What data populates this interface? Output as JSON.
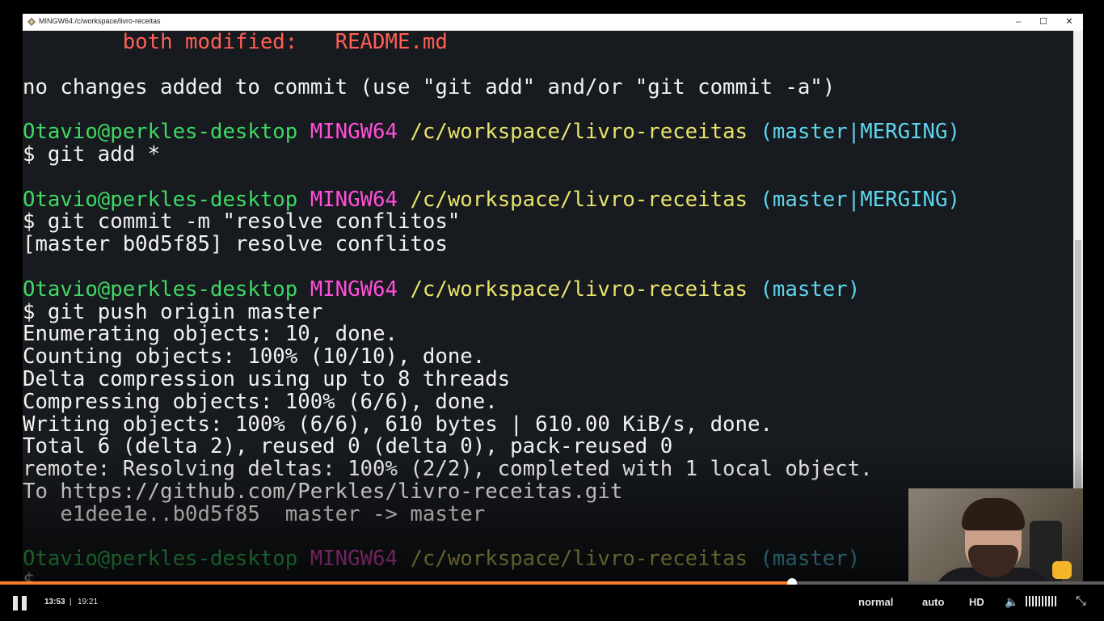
{
  "window": {
    "title": "MINGW64:/c/workspace/livro-receitas",
    "minimize": "–",
    "maximize": "☐",
    "close": "✕"
  },
  "terminal": {
    "lines": [
      {
        "segments": [
          {
            "text": "        both modified:   README.md",
            "color": "red"
          }
        ]
      },
      {
        "segments": [
          {
            "text": "",
            "color": "white"
          }
        ]
      },
      {
        "segments": [
          {
            "text": "no changes added to commit (use \"git add\" and/or \"git commit -a\")",
            "color": "white"
          }
        ]
      },
      {
        "segments": [
          {
            "text": "",
            "color": "white"
          }
        ]
      },
      {
        "segments": [
          {
            "text": "Otavio@perkles-desktop ",
            "color": "green"
          },
          {
            "text": "MINGW64 ",
            "color": "magenta"
          },
          {
            "text": "/c/workspace/livro-receitas ",
            "color": "yellow"
          },
          {
            "text": "(master|MERGING)",
            "color": "cyan"
          }
        ]
      },
      {
        "segments": [
          {
            "text": "$ git add *",
            "color": "white"
          }
        ]
      },
      {
        "segments": [
          {
            "text": "",
            "color": "white"
          }
        ]
      },
      {
        "segments": [
          {
            "text": "Otavio@perkles-desktop ",
            "color": "green"
          },
          {
            "text": "MINGW64 ",
            "color": "magenta"
          },
          {
            "text": "/c/workspace/livro-receitas ",
            "color": "yellow"
          },
          {
            "text": "(master|MERGING)",
            "color": "cyan"
          }
        ]
      },
      {
        "segments": [
          {
            "text": "$ git commit -m \"resolve conflitos\"",
            "color": "white"
          }
        ]
      },
      {
        "segments": [
          {
            "text": "[master b0d5f85] resolve conflitos",
            "color": "white"
          }
        ]
      },
      {
        "segments": [
          {
            "text": "",
            "color": "white"
          }
        ]
      },
      {
        "segments": [
          {
            "text": "Otavio@perkles-desktop ",
            "color": "green"
          },
          {
            "text": "MINGW64 ",
            "color": "magenta"
          },
          {
            "text": "/c/workspace/livro-receitas ",
            "color": "yellow"
          },
          {
            "text": "(master)",
            "color": "cyan"
          }
        ]
      },
      {
        "segments": [
          {
            "text": "$ git push origin master",
            "color": "white"
          }
        ]
      },
      {
        "segments": [
          {
            "text": "Enumerating objects: 10, done.",
            "color": "white"
          }
        ]
      },
      {
        "segments": [
          {
            "text": "Counting objects: 100% (10/10), done.",
            "color": "white"
          }
        ]
      },
      {
        "segments": [
          {
            "text": "Delta compression using up to 8 threads",
            "color": "white"
          }
        ]
      },
      {
        "segments": [
          {
            "text": "Compressing objects: 100% (6/6), done.",
            "color": "white"
          }
        ]
      },
      {
        "segments": [
          {
            "text": "Writing objects: 100% (6/6), 610 bytes | 610.00 KiB/s, done.",
            "color": "white"
          }
        ]
      },
      {
        "segments": [
          {
            "text": "Total 6 (delta 2), reused 0 (delta 0), pack-reused 0",
            "color": "white"
          }
        ]
      },
      {
        "segments": [
          {
            "text": "remote: Resolving deltas: 100% (2/2), completed with 1 local object.",
            "color": "white"
          }
        ]
      },
      {
        "segments": [
          {
            "text": "To https://github.com/Perkles/livro-receitas.git",
            "color": "white"
          }
        ]
      },
      {
        "segments": [
          {
            "text": "   e1dee1e..b0d5f85  master -> master",
            "color": "white"
          }
        ]
      },
      {
        "segments": [
          {
            "text": "",
            "color": "white"
          }
        ]
      },
      {
        "segments": [
          {
            "text": "Otavio@perkles-desktop ",
            "color": "green"
          },
          {
            "text": "MINGW64 ",
            "color": "magenta"
          },
          {
            "text": "/c/workspace/livro-receitas ",
            "color": "yellow"
          },
          {
            "text": "(master)",
            "color": "cyan"
          }
        ]
      },
      {
        "segments": [
          {
            "text": "$ ",
            "color": "white"
          }
        ]
      }
    ]
  },
  "player": {
    "current_time": "13:53",
    "separator": "|",
    "total_time": "19:21",
    "progress_fraction": 0.7175,
    "speed_label": "normal",
    "quality_label": "auto",
    "hd_label": "HD",
    "played_color": "#ff7a2a"
  },
  "colors": {
    "red": "#ff5f56",
    "green": "#3fd964",
    "magenta": "#ff4fd8",
    "yellow": "#e9e36b",
    "cyan": "#5ed6ee",
    "white": "#f2f2f2",
    "terminal_bg": "#171a1e"
  }
}
